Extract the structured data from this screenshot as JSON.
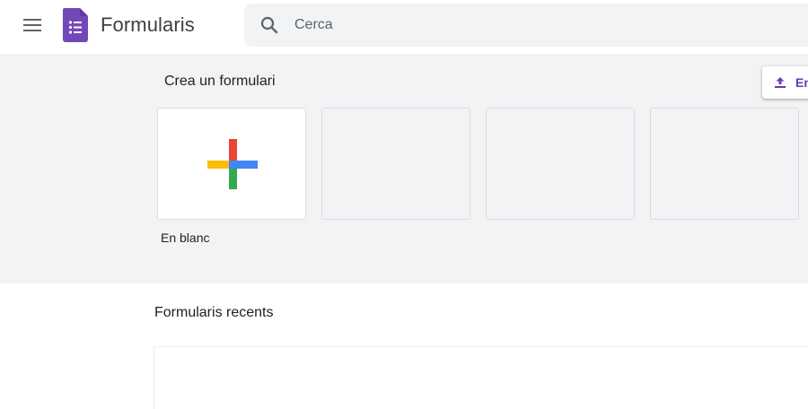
{
  "header": {
    "app_title": "Formularis",
    "menu_icon": "hamburger-menu-icon",
    "logo_icon": "forms-logo-icon",
    "logo_color": "#7248b9",
    "search": {
      "placeholder": "Cerca",
      "value": "",
      "icon": "search-icon"
    }
  },
  "templates": {
    "title": "Crea un formulari",
    "upload_button": {
      "label": "Envia",
      "icon": "upload-icon"
    },
    "blank": {
      "caption": "En blanc",
      "icon": "plus-icon"
    },
    "colors": {
      "red": "#ea4335",
      "blue": "#4285f4",
      "green": "#34a853",
      "yellow": "#fbbc04"
    }
  },
  "recent": {
    "title": "Formularis recents"
  }
}
